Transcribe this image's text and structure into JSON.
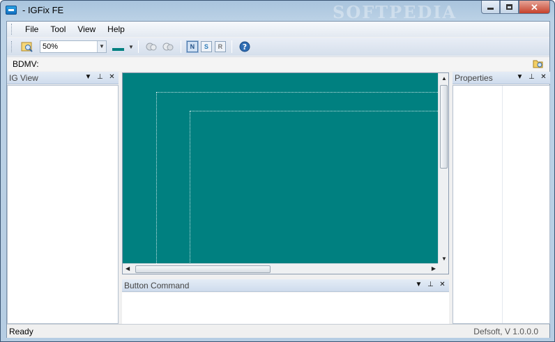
{
  "window": {
    "title": "- IGFix FE",
    "watermark": "SOFTPEDIA",
    "accent": "#008080"
  },
  "menu": {
    "items": [
      "File",
      "Tool",
      "View",
      "Help"
    ]
  },
  "toolbar": {
    "zoom": "50%",
    "color_swatch": "#008080",
    "modes": [
      "N",
      "S",
      "R"
    ]
  },
  "bdmv": {
    "label": "BDMV:"
  },
  "panels": {
    "ig_view": {
      "title": "IG View"
    },
    "properties": {
      "title": "Properties"
    },
    "button_command": {
      "title": "Button Command"
    }
  },
  "status": {
    "left": "Ready",
    "right": "Defsoft, V 1.0.0.0"
  }
}
